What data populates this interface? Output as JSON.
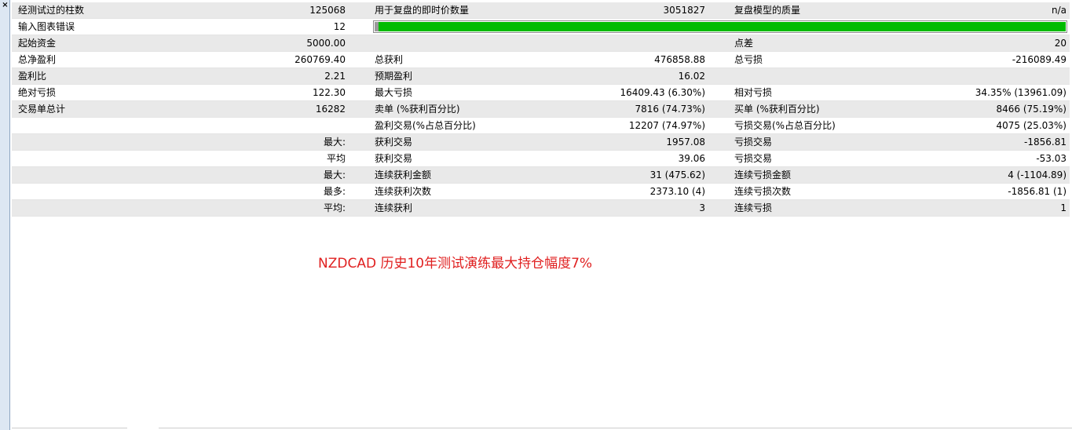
{
  "close_glyph": "×",
  "quality": {
    "value_pct": 100,
    "color": "#00bb00"
  },
  "rows": [
    {
      "label1": "经测试过的柱数",
      "value1": "125068",
      "label2": "用于复盘的即时价数量",
      "value2": "3051827",
      "label3": "复盘模型的质量",
      "value3": "n/a"
    },
    {
      "label1": "输入图表错误",
      "value1": "12",
      "label2": "",
      "value2": "",
      "label3": "",
      "value3": ""
    },
    {
      "label1": "起始资金",
      "value1": "5000.00",
      "label2": "",
      "value2": "",
      "label3": "点差",
      "value3": "20"
    },
    {
      "label1": "总净盈利",
      "value1": "260769.40",
      "label2": "总获利",
      "value2": "476858.88",
      "label3": "总亏损",
      "value3": "-216089.49"
    },
    {
      "label1": "盈利比",
      "value1": "2.21",
      "label2": "预期盈利",
      "value2": "16.02",
      "label3": "",
      "value3": ""
    },
    {
      "label1": "绝对亏损",
      "value1": "122.30",
      "label2": "最大亏损",
      "value2": "16409.43 (6.30%)",
      "label3": "相对亏损",
      "value3": "34.35% (13961.09)"
    },
    {
      "label1": "交易单总计",
      "value1": "16282",
      "label2": "卖单 (%获利百分比)",
      "value2": "7816 (74.73%)",
      "label3": "买单 (%获利百分比)",
      "value3": "8466 (75.19%)"
    },
    {
      "label1": "",
      "value1": "",
      "label2": "盈利交易(%占总百分比)",
      "value2": "12207 (74.97%)",
      "label3": "亏损交易(%占总百分比)",
      "value3": "4075 (25.03%)"
    },
    {
      "label1": "",
      "value1": "最大:",
      "label2": "获利交易",
      "value2": "1957.08",
      "label3": "亏损交易",
      "value3": "-1856.81"
    },
    {
      "label1": "",
      "value1": "平均",
      "label2": "获利交易",
      "value2": "39.06",
      "label3": "亏损交易",
      "value3": "-53.03"
    },
    {
      "label1": "",
      "value1": "最大:",
      "label2": "连续获利金额",
      "value2": "31 (475.62)",
      "label3": "连续亏损金额",
      "value3": "4 (-1104.89)"
    },
    {
      "label1": "",
      "value1": "最多:",
      "label2": "连续获利次数",
      "value2": "2373.10 (4)",
      "label3": "连续亏损次数",
      "value3": "-1856.81 (1)"
    },
    {
      "label1": "",
      "value1": "平均:",
      "label2": "连续获利",
      "value2": "3",
      "label3": "连续亏损",
      "value3": "1"
    }
  ],
  "caption": "NZDCAD  历史10年测试演练最大持仓幅度7%"
}
